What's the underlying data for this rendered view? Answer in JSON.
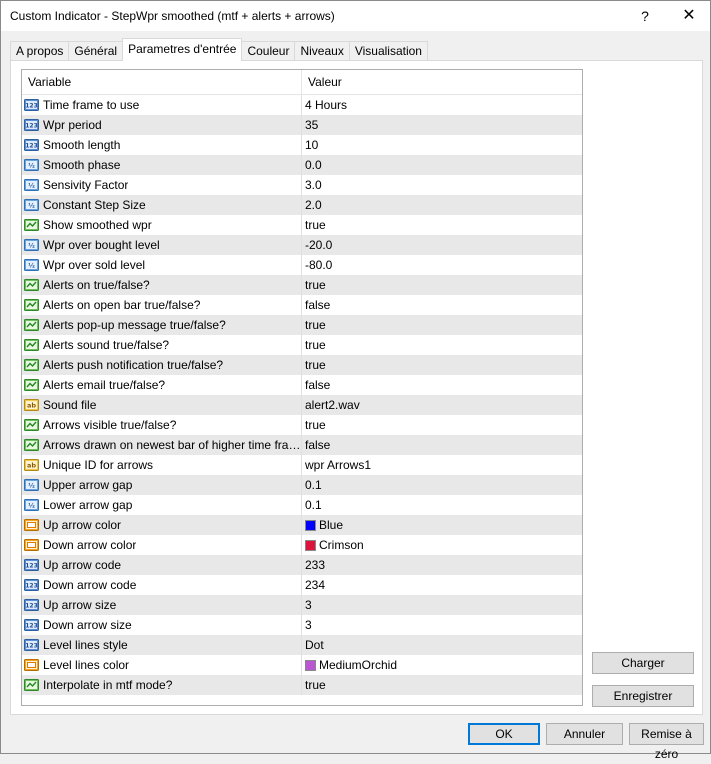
{
  "window": {
    "title": "Custom Indicator - StepWpr smoothed (mtf + alerts + arrows)",
    "help": "?",
    "close": "✕"
  },
  "tabs": [
    {
      "label": "A propos"
    },
    {
      "label": "Général"
    },
    {
      "label": "Parametres d'entrée",
      "active": true
    },
    {
      "label": "Couleur"
    },
    {
      "label": "Niveaux"
    },
    {
      "label": "Visualisation"
    }
  ],
  "grid": {
    "headers": {
      "variable": "Variable",
      "value": "Valeur"
    },
    "rows": [
      {
        "icon": "int",
        "name": "Time frame to use",
        "value": "4 Hours"
      },
      {
        "icon": "int",
        "name": "Wpr period",
        "value": "35"
      },
      {
        "icon": "int",
        "name": "Smooth length",
        "value": "10"
      },
      {
        "icon": "double",
        "name": "Smooth phase",
        "value": "0.0"
      },
      {
        "icon": "double",
        "name": "Sensivity Factor",
        "value": "3.0"
      },
      {
        "icon": "double",
        "name": "Constant Step Size",
        "value": "2.0"
      },
      {
        "icon": "bool",
        "name": "Show smoothed wpr",
        "value": "true"
      },
      {
        "icon": "double",
        "name": "Wpr over bought level",
        "value": "-20.0"
      },
      {
        "icon": "double",
        "name": "Wpr over sold level",
        "value": "-80.0"
      },
      {
        "icon": "bool",
        "name": "Alerts on true/false?",
        "value": "true"
      },
      {
        "icon": "bool",
        "name": "Alerts on open bar true/false?",
        "value": "false"
      },
      {
        "icon": "bool",
        "name": "Alerts pop-up message true/false?",
        "value": "true"
      },
      {
        "icon": "bool",
        "name": "Alerts sound true/false?",
        "value": "true"
      },
      {
        "icon": "bool",
        "name": "Alerts push notification true/false?",
        "value": "true"
      },
      {
        "icon": "bool",
        "name": "Alerts email true/false?",
        "value": "false"
      },
      {
        "icon": "string",
        "name": "Sound file",
        "value": "alert2.wav"
      },
      {
        "icon": "bool",
        "name": "Arrows visible true/false?",
        "value": "true"
      },
      {
        "icon": "bool",
        "name": "Arrows drawn on newest bar of higher time frame ba...",
        "value": "false"
      },
      {
        "icon": "string",
        "name": "Unique ID for arrows",
        "value": "wpr Arrows1"
      },
      {
        "icon": "double",
        "name": "Upper arrow gap",
        "value": "0.1"
      },
      {
        "icon": "double",
        "name": "Lower arrow gap",
        "value": "0.1"
      },
      {
        "icon": "color",
        "name": "Up arrow color",
        "value": "Blue",
        "swatch": "#0000ff"
      },
      {
        "icon": "color",
        "name": "Down arrow color",
        "value": "Crimson",
        "swatch": "#dc143c"
      },
      {
        "icon": "int",
        "name": "Up arrow code",
        "value": "233"
      },
      {
        "icon": "int",
        "name": "Down arrow code",
        "value": "234"
      },
      {
        "icon": "int",
        "name": "Up arrow size",
        "value": "3"
      },
      {
        "icon": "int",
        "name": "Down arrow size",
        "value": "3"
      },
      {
        "icon": "int",
        "name": "Level lines style",
        "value": "Dot"
      },
      {
        "icon": "color",
        "name": "Level lines color",
        "value": "MediumOrchid",
        "swatch": "#ba55d3"
      },
      {
        "icon": "bool",
        "name": "Interpolate in mtf mode?",
        "value": "true"
      }
    ]
  },
  "side_buttons": {
    "load": "Charger",
    "save": "Enregistrer"
  },
  "footer_buttons": {
    "ok": "OK",
    "cancel": "Annuler",
    "reset": "Remise à zéro"
  }
}
